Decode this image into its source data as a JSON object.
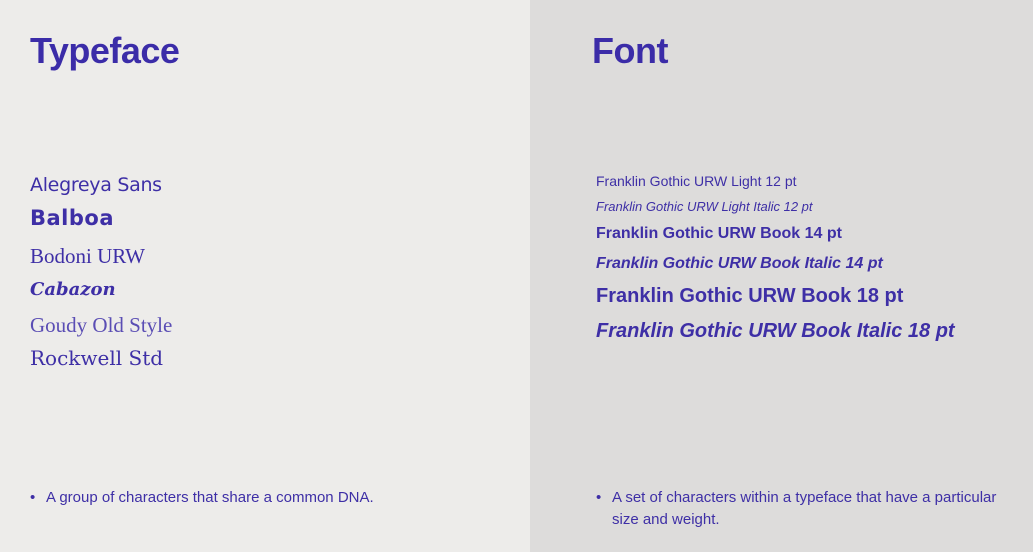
{
  "typeface": {
    "heading": "Typeface",
    "samples": [
      "Alegreya Sans",
      "Balboa",
      "Bodoni URW",
      "Cabazon",
      "Goudy Old Style",
      "Rockwell Std"
    ],
    "bullet": "A group of characters that share a common DNA."
  },
  "font": {
    "heading": "Font",
    "samples": [
      "Franklin Gothic URW Light 12 pt",
      "Franklin Gothic URW Light Italic 12 pt",
      "Franklin Gothic URW Book 14 pt",
      "Franklin Gothic URW Book Italic 14 pt",
      "Franklin Gothic URW Book 18 pt",
      "Franklin Gothic URW Book Italic 18 pt"
    ],
    "bullet": "A set of characters within a typeface that have a particular size and weight."
  },
  "bullet_symbol": "•",
  "colors": {
    "accent": "#3e2fa6",
    "left_background": "#edecea",
    "right_background": "#dddcdb"
  }
}
